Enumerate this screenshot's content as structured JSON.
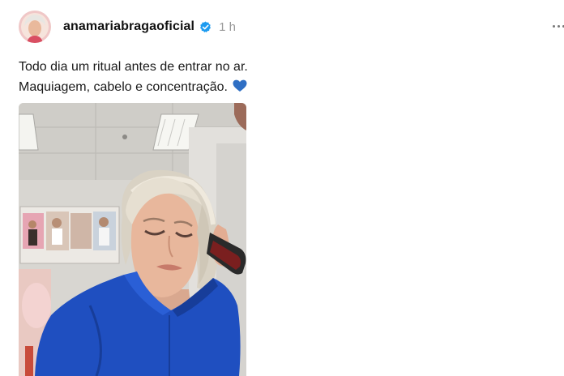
{
  "post": {
    "username": "anamariabragaoficial",
    "time": "1 h",
    "caption_lines": [
      "Todo dia um ritual antes de entrar no ar.",
      "Maquiagem, cabelo e concentração."
    ],
    "caption_emoji": "blue-heart-icon"
  },
  "colors": {
    "verified": "#1d9bf0",
    "heart": "#2f6fc4",
    "shirt": "#1f4fc0",
    "muted_text": "#999999"
  },
  "icons": {
    "verified": "verified-badge-icon",
    "more": "more-options-icon"
  }
}
